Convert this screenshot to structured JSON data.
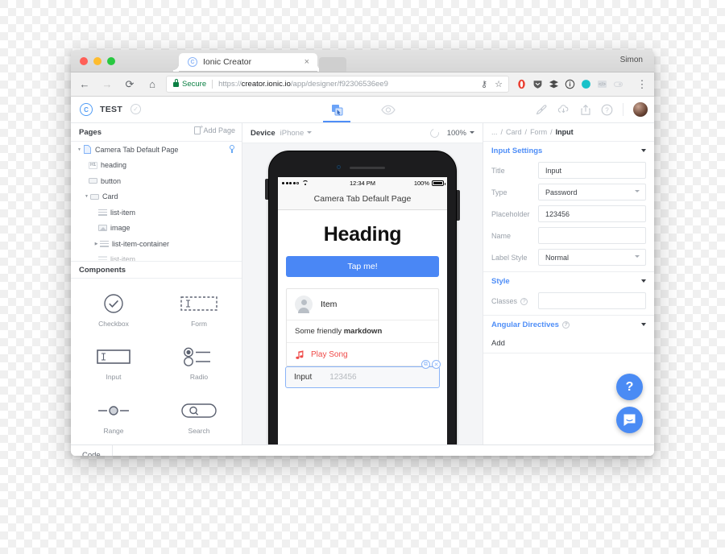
{
  "browser": {
    "tab_title": "Ionic Creator",
    "tab_close": "×",
    "favicon": "ionic-logo-icon",
    "user_name": "Simon",
    "secure_label": "Secure",
    "url_scheme": "https://",
    "url_domain": "creator.ionic.io",
    "url_path": "/app/designer/f92306536ee9",
    "back_icon": "←",
    "forward_icon": "→",
    "reload_icon": "⟳",
    "home_icon": "⌂",
    "key_icon": "⚷",
    "star_icon": "☆",
    "menu_icon": "⋮",
    "extensions": [
      "opera-icon",
      "shield-icon",
      "layers-icon",
      "info-icon",
      "teal-dot-icon",
      "code-icon",
      "toggle-icon"
    ]
  },
  "app_header": {
    "logo": "C",
    "project_name": "TEST",
    "saved_check": "✓",
    "tabs": [
      {
        "name": "design-tab",
        "icon": "drag-layers-icon",
        "active": true
      },
      {
        "name": "preview-tab",
        "icon": "eye-icon",
        "active": false
      }
    ],
    "actions": [
      "paintbrush-icon",
      "cloud-download-icon",
      "share-icon",
      "help-icon"
    ],
    "avatar": "user-avatar"
  },
  "left_panel": {
    "pages_title": "Pages",
    "add_page_label": "Add Page",
    "tree": [
      {
        "label": "Camera Tab Default Page",
        "indent": 0,
        "caret": "down",
        "icon": "page-icon",
        "pinned": true
      },
      {
        "label": "heading",
        "indent": 1,
        "caret": "none",
        "icon": "h1-icon"
      },
      {
        "label": "button",
        "indent": 1,
        "caret": "none",
        "icon": "button-icon"
      },
      {
        "label": "Card",
        "indent": 1,
        "caret": "down",
        "icon": "card-icon"
      },
      {
        "label": "list-item",
        "indent": 2,
        "caret": "none",
        "icon": "list-icon"
      },
      {
        "label": "image",
        "indent": 2,
        "caret": "none",
        "icon": "image-icon"
      },
      {
        "label": "list-item-container",
        "indent": 2,
        "caret": "right",
        "icon": "list-icon"
      },
      {
        "label": "list-item",
        "indent": 2,
        "caret": "none",
        "icon": "list-icon"
      }
    ],
    "components_title": "Components",
    "components": [
      {
        "label": "Checkbox",
        "icon": "checkbox-icon"
      },
      {
        "label": "Form",
        "icon": "form-icon"
      },
      {
        "label": "Input",
        "icon": "input-icon"
      },
      {
        "label": "Radio",
        "icon": "radio-icon"
      },
      {
        "label": "Range",
        "icon": "range-icon"
      },
      {
        "label": "Search",
        "icon": "search-icon"
      }
    ]
  },
  "device_bar": {
    "device_label": "Device",
    "device_value": "iPhone",
    "refresh_icon": "refresh-icon",
    "zoom_value": "100%"
  },
  "phone": {
    "status": {
      "time": "12:34 PM",
      "battery_percent": "100%",
      "carrier_dots": 5,
      "wifi": "wifi-icon"
    },
    "nav_title": "Camera Tab Default Page",
    "heading": "Heading",
    "button_label": "Tap me!",
    "item_label": "Item",
    "markdown_prefix": "Some friendly ",
    "markdown_bold": "markdown",
    "play_song_label": "Play Song",
    "play_song_icon": "music-note-icon",
    "input_label": "Input",
    "input_placeholder": "123456",
    "handle_duplicate": "⧉",
    "handle_close": "✕"
  },
  "right_panel": {
    "breadcrumb": [
      {
        "label": "...",
        "active": false
      },
      {
        "label": "Card",
        "active": false
      },
      {
        "label": "Form",
        "active": false
      },
      {
        "label": "Input",
        "active": true
      }
    ],
    "sections": [
      {
        "title": "Input Settings",
        "fields": [
          {
            "label": "Title",
            "value": "Input",
            "type": "text"
          },
          {
            "label": "Type",
            "value": "Password",
            "type": "select"
          },
          {
            "label": "Placeholder",
            "value": "123456",
            "type": "text"
          },
          {
            "label": "Name",
            "value": "",
            "type": "text"
          },
          {
            "label": "Label Style",
            "value": "Normal",
            "type": "select"
          }
        ]
      },
      {
        "title": "Style",
        "fields": [
          {
            "label": "Classes",
            "value": "",
            "type": "text",
            "help": true
          }
        ]
      },
      {
        "title": "Angular Directives",
        "help": true,
        "add_label": "Add"
      }
    ]
  },
  "fabs": [
    {
      "name": "help-fab",
      "glyph": "?"
    },
    {
      "name": "intercom-chat-fab",
      "glyph": "chat-icon"
    }
  ],
  "bottom_bar": {
    "code_tab": "Code"
  },
  "colors": {
    "accent": "#4f8ef7",
    "button": "#4a87f5",
    "danger": "#ef4a48",
    "panel_border": "#e7e9ec",
    "canvas": "#f4f5f7"
  }
}
